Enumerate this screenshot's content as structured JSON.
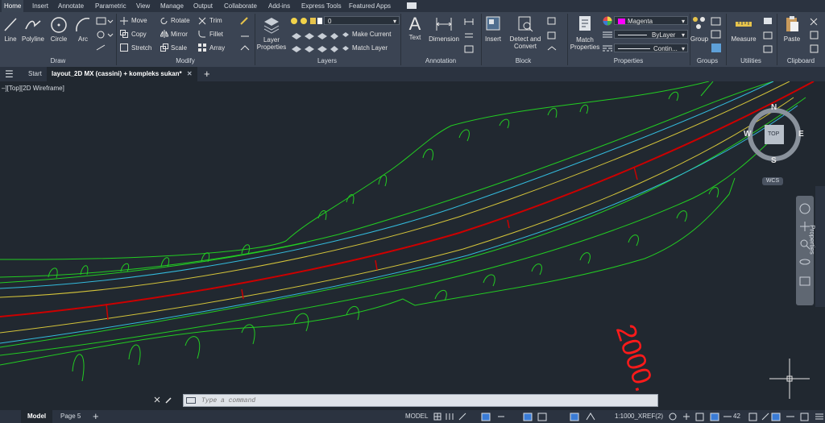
{
  "menu": {
    "tabs": [
      "Home",
      "Insert",
      "Annotate",
      "Parametric",
      "View",
      "Manage",
      "Output",
      "Collaborate",
      "Add-ins",
      "Express Tools",
      "Featured Apps"
    ],
    "active": "Home"
  },
  "ribbon": {
    "draw": {
      "panel": "Draw",
      "line": "Line",
      "polyline": "Polyline",
      "circle": "Circle",
      "arc": "Arc"
    },
    "modify": {
      "panel": "Modify",
      "move": "Move",
      "rotate": "Rotate",
      "trim": "Trim",
      "copy": "Copy",
      "mirror": "Mirror",
      "fillet": "Fillet",
      "stretch": "Stretch",
      "scale": "Scale",
      "array": "Array"
    },
    "layers": {
      "panel": "Layers",
      "layer_properties_1": "Layer",
      "layer_properties_2": "Properties",
      "current_layer": "0",
      "make_current": "Make Current",
      "match_layer": "Match Layer"
    },
    "annotation": {
      "panel": "Annotation",
      "text": "Text",
      "dimension": "Dimension"
    },
    "block": {
      "panel": "Block",
      "insert": "Insert",
      "detect_1": "Detect and",
      "detect_2": "Convert"
    },
    "properties": {
      "panel": "Properties",
      "match_1": "Match",
      "match_2": "Properties",
      "color": "Magenta",
      "color_hex": "#ff00ff",
      "lineweight": "ByLayer",
      "linetype": "Contin..."
    },
    "groups": {
      "panel": "Groups",
      "group": "Group"
    },
    "utilities": {
      "panel": "Utilities",
      "measure": "Measure"
    },
    "clipboard": {
      "panel": "Clipboard",
      "paste": "Paste"
    }
  },
  "file_tabs": {
    "start": "Start",
    "active": "layout_2D MX (cassini) + kompleks sukan*"
  },
  "viewport": {
    "label": "–][Top][2D Wireframe]",
    "viewcube": {
      "north": "N",
      "south": "S",
      "east": "E",
      "west": "W",
      "top": "TOP",
      "wcs": "WCS"
    },
    "properties_palette": "Properties",
    "chainage_text": "2000.",
    "colors": {
      "boundary": "#22cc22",
      "centerline": "#cc0000",
      "cyan": "#33bbdd",
      "yellow": "#d4c43a",
      "text": "#ff1a1a"
    }
  },
  "command": {
    "placeholder": "Type a command"
  },
  "status": {
    "model_tab": "Model",
    "layout_tab": "Page 5",
    "model": "MODEL",
    "scale": "1:1000_XREF(2)",
    "number": "42"
  }
}
